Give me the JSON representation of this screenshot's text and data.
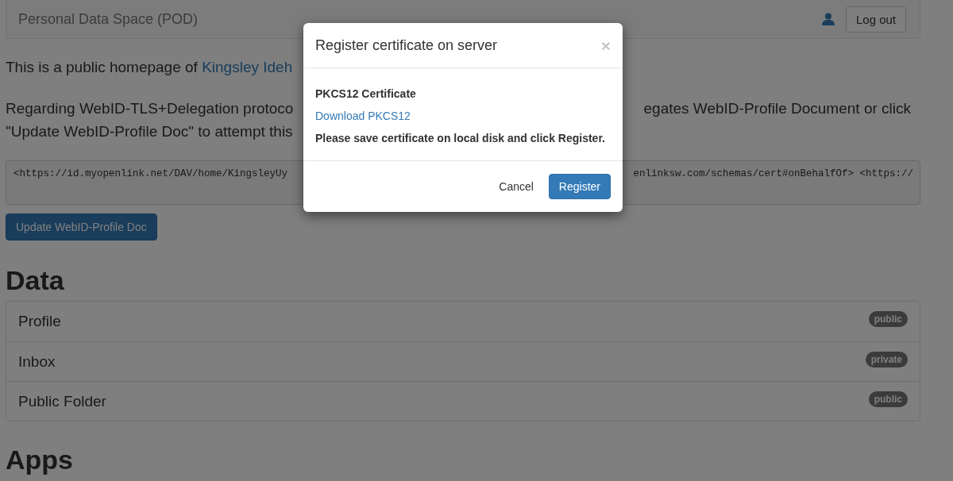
{
  "navbar": {
    "brand": "Personal Data Space (POD)",
    "logout": "Log out"
  },
  "intro": {
    "text": "This is a public homepage of ",
    "link": "Kingsley Ideh"
  },
  "delegation_note": [
    {
      "left": "Regarding WebID-TLS+Delegation protoco",
      "right": "egates WebID-Profile Document or click"
    },
    {
      "left": "\"Update WebID-Profile Doc\" to attempt this"
    }
  ],
  "code": {
    "left": "<https://id.myopenlink.net/DAV/home/KingsleyUy",
    "right": "enlinksw.com/schemas/cert#onBehalfOf> <https://"
  },
  "update_button": "Update WebID-Profile Doc",
  "data": {
    "heading": "Data",
    "items": [
      {
        "name": "Profile",
        "badge": "public"
      },
      {
        "name": "Inbox",
        "badge": "private"
      },
      {
        "name": "Public Folder",
        "badge": "public"
      }
    ]
  },
  "apps_heading": "Apps",
  "modal": {
    "title": "Register certificate on server",
    "close": "×",
    "label": "PKCS12 Certificate",
    "link": "Download PKCS12",
    "message": "Please save certificate on local disk and click Register.",
    "buttons": [
      {
        "label": "Cancel",
        "kind": "link"
      },
      {
        "label": "Register",
        "kind": "primary"
      }
    ]
  }
}
